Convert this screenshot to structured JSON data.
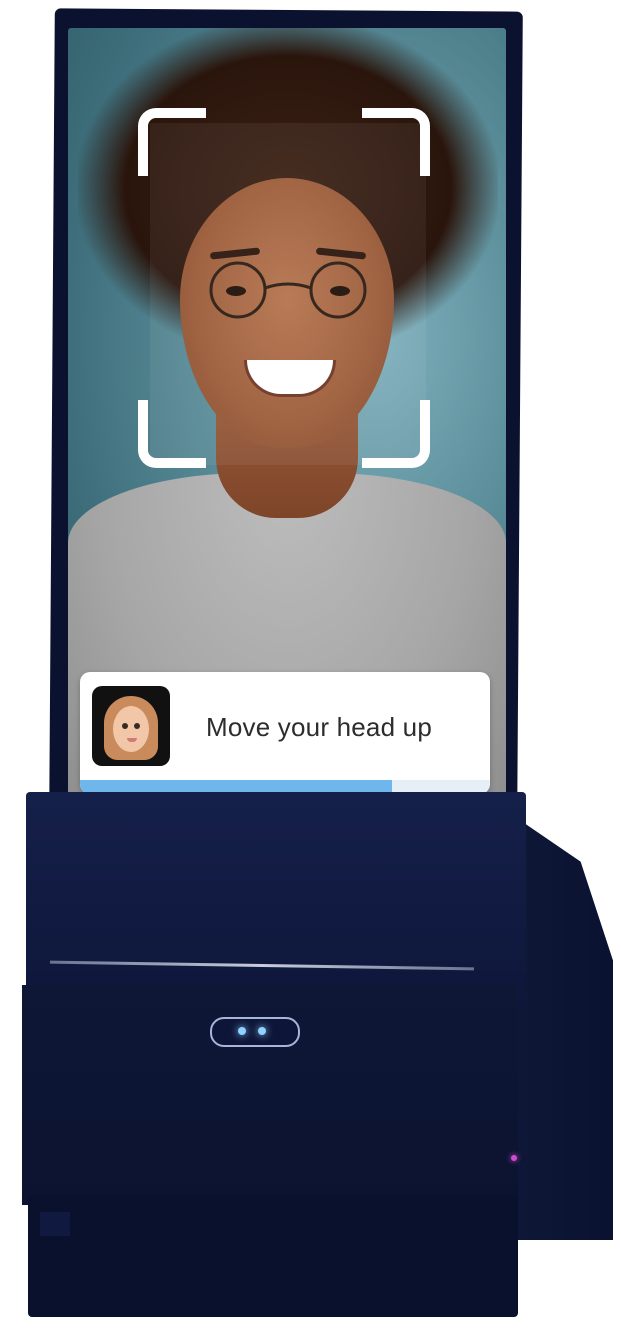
{
  "kiosk": {
    "prompt": {
      "avatar_icon": "memoji-avatar-icon",
      "instruction": "Move your head up",
      "progress": 0.76
    },
    "scan_frame_icon": "face-scan-frame-icon",
    "sensor_icon": "camera-sensor-icon"
  }
}
